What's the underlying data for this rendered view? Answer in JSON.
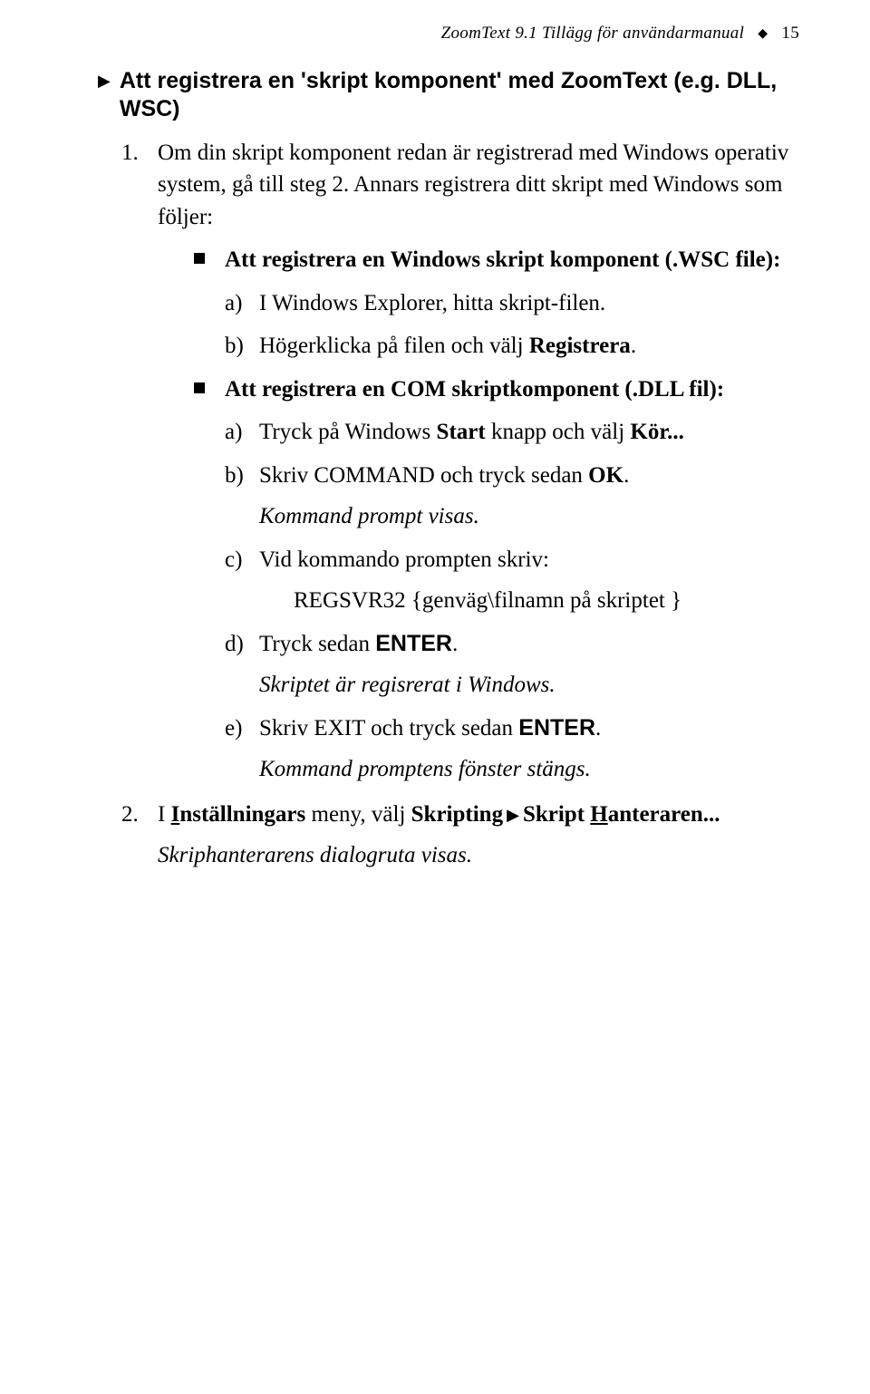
{
  "runhead": {
    "title_italic": "ZoomText 9.1 Tillägg för användarmanual",
    "diamond": "◆",
    "page_number": "15"
  },
  "section_heading": {
    "arrow": "▶",
    "text": "Att registrera en 'skript komponent' med ZoomText (e.g. DLL, WSC)"
  },
  "step1": {
    "intro": "Om din skript komponent redan är registrerad med Windows operativ system, gå till steg 2. Annars registrera ditt skript med Windows som följer:",
    "bullets": {
      "wsc": {
        "title_prefix": "Att registrera en Windows skript komponent (.WSC file):",
        "a": "I Windows Explorer, hitta skript-filen.",
        "b_pre": "Högerklicka på filen och välj ",
        "b_bold": "Registrera",
        "b_post": "."
      },
      "com": {
        "title_prefix": "Att registrera en COM skriptkomponent (.DLL fil):",
        "a_pre": "Tryck på Windows ",
        "a_bold1": "Start",
        "a_mid": " knapp och välj ",
        "a_bold2": "Kör...",
        "b_pre": "Skriv COMMAND och tryck sedan ",
        "b_bold": "OK",
        "b_post": ".",
        "note_after_b": "Kommand prompt visas.",
        "c_text": "Vid kommando prompten skriv:",
        "c_cmd": "REGSVR32 {genväg\\filnamn på skriptet }",
        "d_pre": "Tryck sedan ",
        "d_sans": "ENTER",
        "d_post": ".",
        "note_after_d": "Skriptet är regisrerat i Windows.",
        "e_pre": "Skriv EXIT och tryck sedan ",
        "e_sans": "ENTER",
        "e_post": ".",
        "note_after_e": "Kommand promptens fönster stängs."
      }
    }
  },
  "step2": {
    "pre": "I ",
    "u_i": "I",
    "rest1": "nställningars",
    "mid1": " meny, välj ",
    "bold1": "Skripting",
    "arrow": "▶",
    "bold2_pre": "Skript ",
    "u_h": "H",
    "bold2_post": "anteraren...",
    "note": "Skriphanterarens dialogruta visas."
  }
}
